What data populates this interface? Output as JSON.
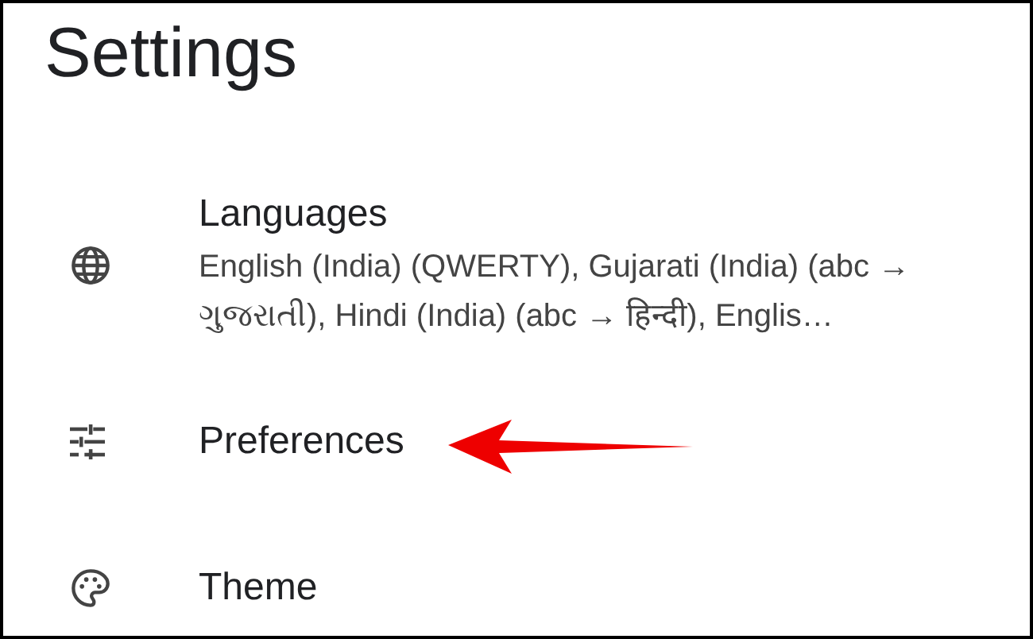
{
  "title": "Settings",
  "items": [
    {
      "label": "Languages",
      "summary": "English (India) (QWERTY), Gujarati (India) (abc → ગુજરાતી), Hindi (India) (abc → हिन्दी), Englis…"
    },
    {
      "label": "Preferences"
    },
    {
      "label": "Theme"
    }
  ]
}
